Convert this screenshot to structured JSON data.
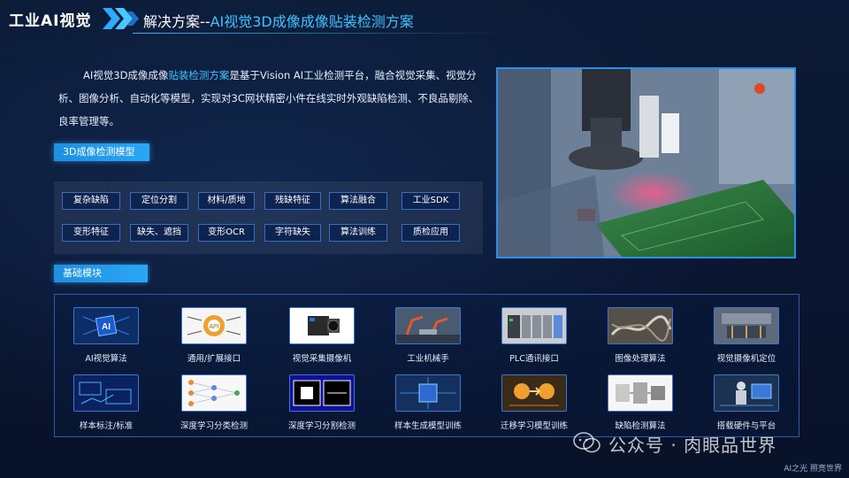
{
  "header": {
    "brand": "工业AI视觉",
    "title_prefix": "解决方案--",
    "title_highlight": "AI视觉3D成像成像贴装检测方案"
  },
  "intro": {
    "part1": "AI视觉3D成像成像",
    "highlight": "贴装检测方案",
    "part2": "是基于Vision AI工业检测平台，融合视觉采集、视觉分析、图像分析、自动化等模型，实现对3C网状精密小件在线实时外观缺陷检测、不良品剔除、良率管理等。"
  },
  "model_section": {
    "label": "3D成像检测模型",
    "tags_row1": [
      "复杂缺陷",
      "定位分割",
      "材料/质地",
      "残缺特征",
      "算法融合",
      "工业SDK"
    ],
    "tags_row2": [
      "变形特征",
      "缺失、遮挡",
      "变形OCR",
      "字符缺失",
      "算法训练",
      "质检应用"
    ]
  },
  "basic_section": {
    "label": "基础模块",
    "row1": [
      {
        "label": "AI视觉算法",
        "icon": "ai-chip-icon"
      },
      {
        "label": "通用/扩展接口",
        "icon": "api-gear-icon"
      },
      {
        "label": "视觉采集摄像机",
        "icon": "camera-icon"
      },
      {
        "label": "工业机械手",
        "icon": "robot-arm-icon"
      },
      {
        "label": "PLC通讯接口",
        "icon": "plc-icon"
      },
      {
        "label": "图像处理算法",
        "icon": "image-processing-icon"
      },
      {
        "label": "视觉摄像机定位",
        "icon": "camera-positioning-icon"
      }
    ],
    "row2": [
      {
        "label": "样本标注/标准",
        "icon": "annotation-icon"
      },
      {
        "label": "深度学习分类检测",
        "icon": "neural-network-icon"
      },
      {
        "label": "深度学习分割检测",
        "icon": "segmentation-icon"
      },
      {
        "label": "样本生成模型训练",
        "icon": "sample-generation-icon"
      },
      {
        "label": "迁移学习模型训练",
        "icon": "transfer-learning-icon"
      },
      {
        "label": "缺陷检测算法",
        "icon": "defect-detection-icon"
      },
      {
        "label": "搭载硬件与平台",
        "icon": "hardware-platform-icon"
      }
    ]
  },
  "watermark": "公众号 · 肉眼品世界",
  "footer": "AI之光  照亮世界",
  "colors": {
    "background": "#0a1730",
    "accent": "#3fc3ff",
    "label_bg": "#1f8fe0",
    "tag_border": "#3a6cc0"
  }
}
